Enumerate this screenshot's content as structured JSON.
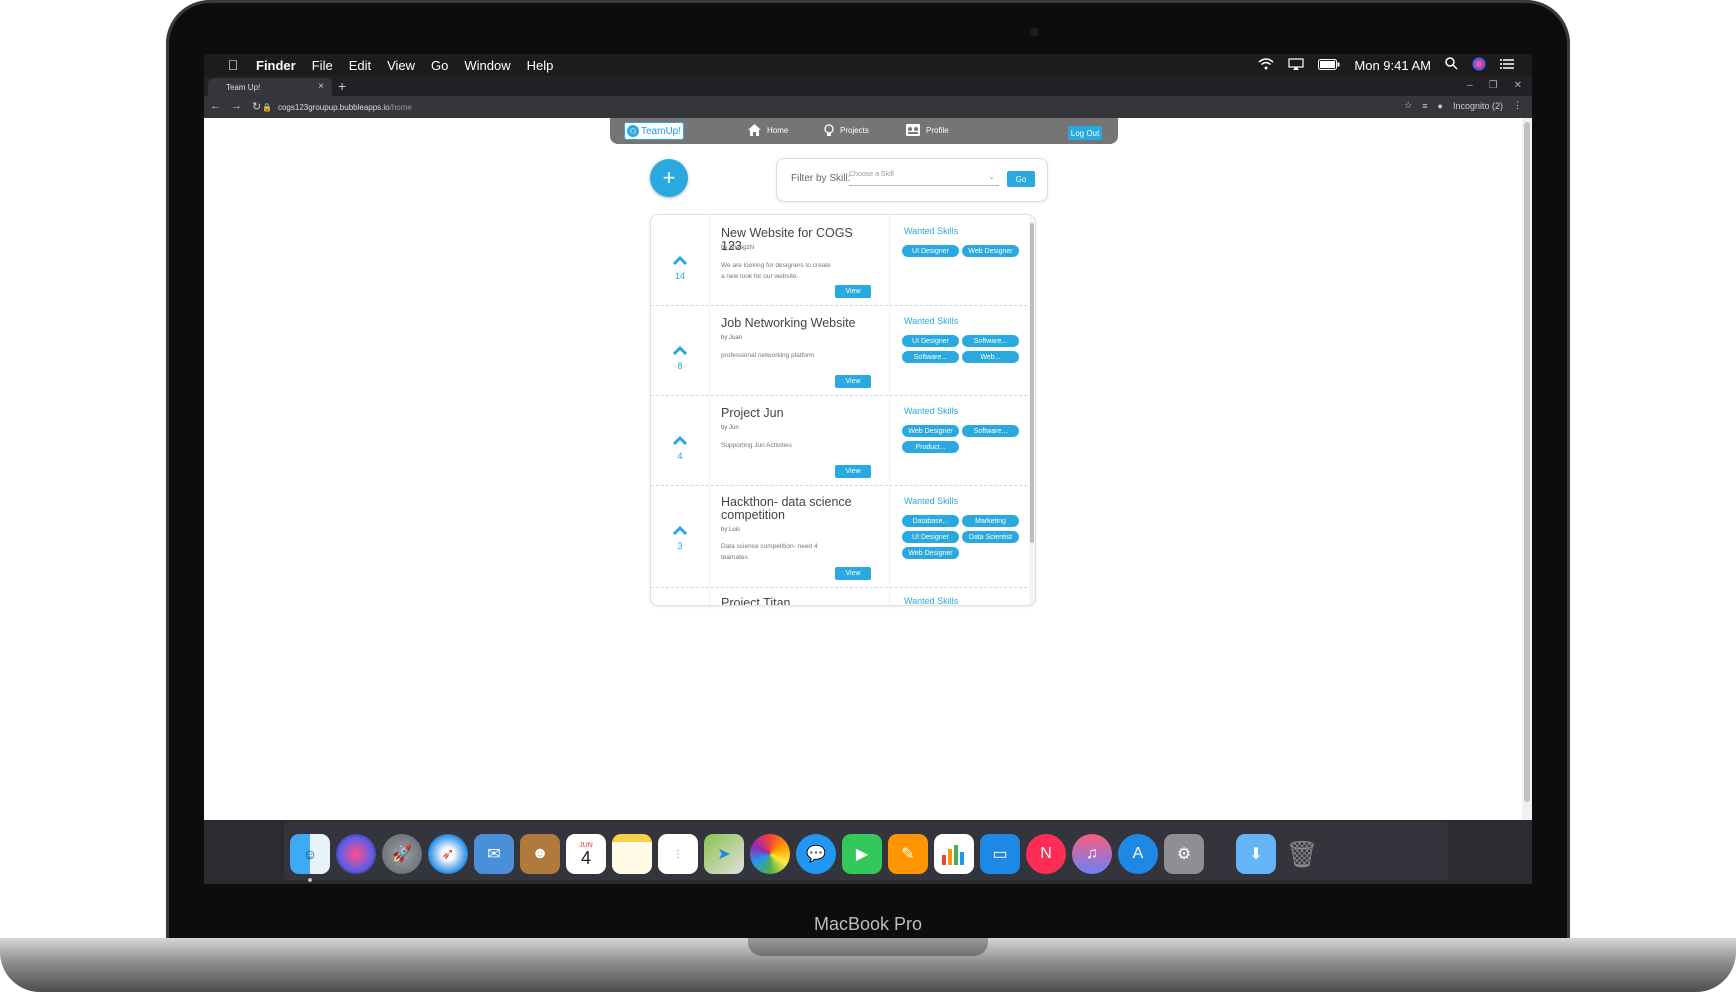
{
  "device": {
    "label": "MacBook Pro"
  },
  "menubar": {
    "apple": "",
    "items": [
      "Finder",
      "File",
      "Edit",
      "View",
      "Go",
      "Window",
      "Help"
    ],
    "clock": "Mon 9:41 AM"
  },
  "browser": {
    "tab_title": "Team Up!",
    "url_host": "cogs123groupup.bubbleapps.io",
    "url_path": "/home",
    "incognito": "Incognito (2)"
  },
  "app": {
    "logo": "TeamUp!",
    "nav": {
      "home": "Home",
      "projects": "Projects",
      "profile": "Profile",
      "logout": "Log Out"
    },
    "add_label": "+",
    "filter": {
      "label": "Filter by Skill:",
      "placeholder": "Choose a Skill",
      "go": "Go"
    },
    "accent": "#29a9e0"
  },
  "projects": [
    {
      "title": "New Website for COGS 123",
      "by": "by Shengzhi",
      "desc": "We are looking for designers to create a new look for our website.",
      "votes": "14",
      "view": "View",
      "wanted": "Wanted Skills",
      "skills": [
        "UI Designer",
        "Web Designer"
      ]
    },
    {
      "title": "Job Networking Website",
      "by": "by Juan",
      "desc": "professional networking platform",
      "votes": "8",
      "view": "View",
      "wanted": "Wanted Skills",
      "skills": [
        "UI Designer",
        "Software...",
        "Software...",
        "Web..."
      ]
    },
    {
      "title": "Project Jun",
      "by": "by Jun",
      "desc": "Supporting Jun Activities",
      "votes": "4",
      "view": "View",
      "wanted": "Wanted Skills",
      "skills": [
        "Web Designer",
        "Software...",
        "Product..."
      ]
    },
    {
      "title": "Hackthon- data science competition",
      "by": "by Luis",
      "desc": "Data science competition- need 4 teamates",
      "votes": "3",
      "view": "View",
      "wanted": "Wanted Skills",
      "skills": [
        "Database...",
        "Marketing",
        "UI Designer",
        "Data Scientist",
        "Web Designer"
      ]
    },
    {
      "title": "Project Titan",
      "wanted": "Wanted Skills"
    }
  ],
  "dock": {
    "calendar_month": "JUN",
    "calendar_day": "4",
    "icons": [
      "finder-icon",
      "siri-icon",
      "launchpad-icon",
      "safari-icon",
      "mail-icon",
      "contacts-icon",
      "calendar-icon",
      "notes-icon",
      "reminders-icon",
      "maps-icon",
      "photos-icon",
      "messages-icon",
      "facetime-icon",
      "pages-icon",
      "numbers-icon",
      "keynote-icon",
      "news-icon",
      "music-icon",
      "app-store-icon",
      "system-preferences-icon",
      "downloads-folder-icon",
      "trash-icon"
    ]
  }
}
